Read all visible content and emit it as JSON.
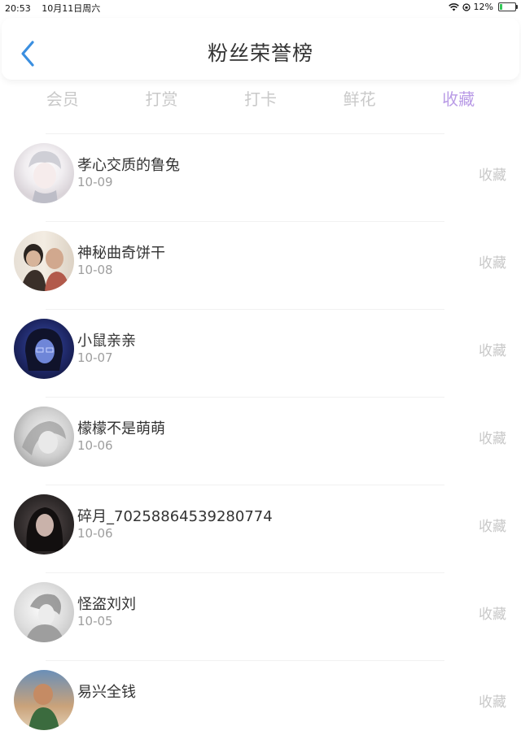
{
  "status_bar": {
    "time": "20:53",
    "date": "10月11日周六",
    "battery_percent": "12%",
    "icons": [
      "wifi-icon",
      "orientation-lock-icon",
      "battery-icon"
    ]
  },
  "header": {
    "title": "粉丝荣誉榜",
    "back_icon": "chevron-left-icon"
  },
  "tabs": [
    {
      "label": "会员",
      "active": false
    },
    {
      "label": "打赏",
      "active": false
    },
    {
      "label": "打卡",
      "active": false
    },
    {
      "label": "鲜花",
      "active": false
    },
    {
      "label": "收藏",
      "active": true
    }
  ],
  "colors": {
    "accent": "#b99be6",
    "back_icon": "#3b8fe0",
    "inactive_tab": "#c9c9c9",
    "action_text": "#c8c8c8"
  },
  "fans": [
    {
      "name": "孝心交质的鲁兔",
      "date": "10-09",
      "action": "收藏"
    },
    {
      "name": "神秘曲奇饼干",
      "date": "10-08",
      "action": "收藏"
    },
    {
      "name": "小鼠亲亲",
      "date": "10-07",
      "action": "收藏"
    },
    {
      "name": "檬檬不是萌萌",
      "date": "10-06",
      "action": "收藏"
    },
    {
      "name": "碎月_70258864539280774",
      "date": "10-06",
      "action": "收藏"
    },
    {
      "name": "怪盗刘刘",
      "date": "10-05",
      "action": "收藏"
    },
    {
      "name": "易兴全钱",
      "date": "",
      "action": "收藏"
    }
  ]
}
